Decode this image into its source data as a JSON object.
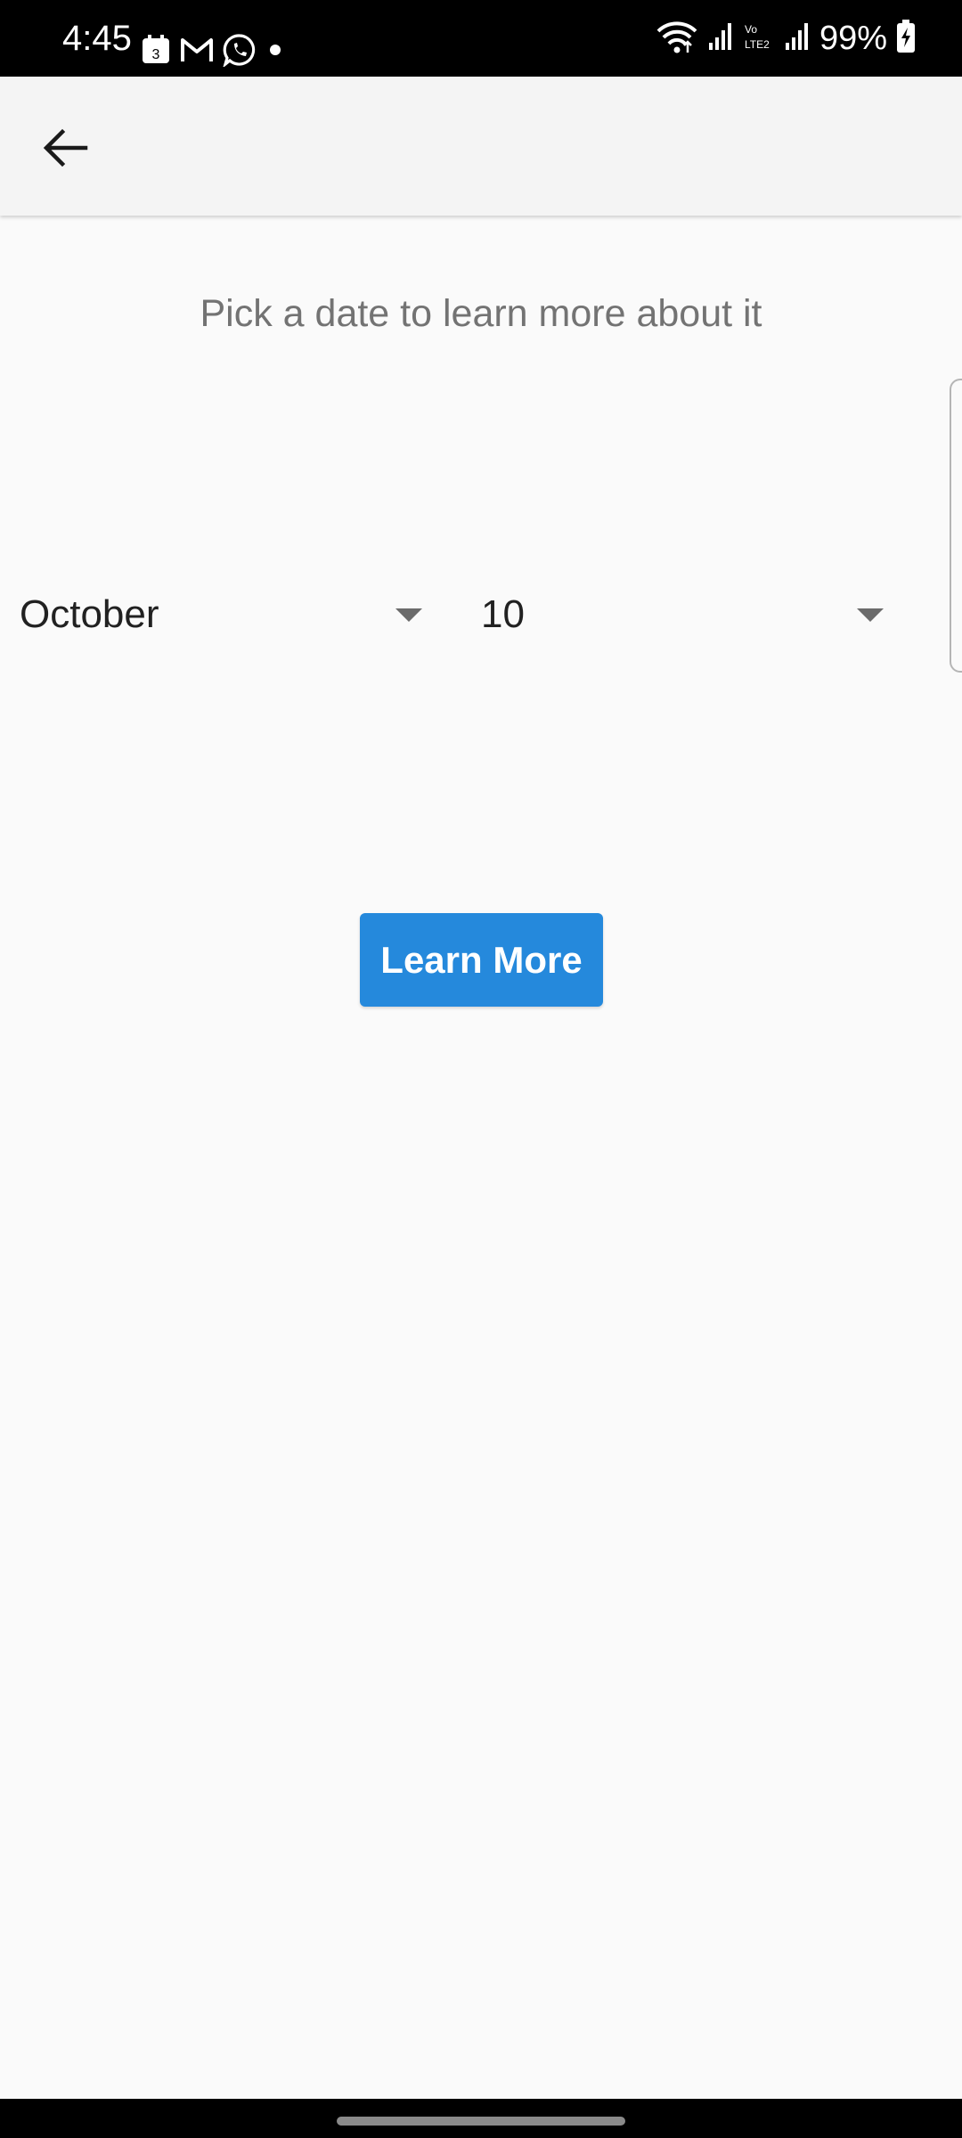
{
  "status_bar": {
    "time": "4:45",
    "notification_icons": [
      "calendar-icon",
      "gmail-icon",
      "whatsapp-icon",
      "dot-icon"
    ],
    "calendar_day": "3",
    "volte_label": "Vo\nLTE2",
    "battery_percent": "99%"
  },
  "app_bar": {
    "back_icon": "arrow-back-icon"
  },
  "main": {
    "prompt": "Pick a date to learn more about it",
    "month_dropdown": {
      "selected": "October"
    },
    "day_dropdown": {
      "selected": "10"
    },
    "learn_more_label": "Learn More"
  },
  "colors": {
    "status_bar_bg": "#000000",
    "app_bar_bg": "#f4f4f4",
    "page_bg": "#fafafa",
    "button_bg": "#2589dc",
    "button_text": "#ffffff",
    "prompt_text": "#737373"
  }
}
